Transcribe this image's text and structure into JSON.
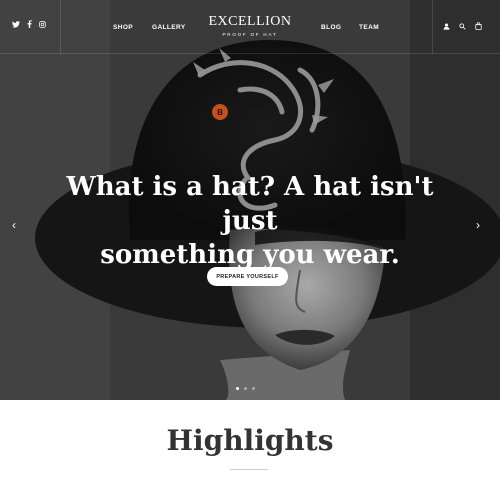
{
  "nav": {
    "social_icons": [
      "twitter-icon",
      "facebook-icon",
      "instagram-icon"
    ],
    "links_left": [
      "SHOP",
      "GALLERY"
    ],
    "links_right": [
      "BLOG",
      "TEAM"
    ],
    "logo": {
      "main": "EXCELLION",
      "sub": "PROOF OF HAT"
    },
    "icons_right": [
      "user-icon",
      "search-icon",
      "cart-icon"
    ]
  },
  "hero": {
    "headline_line1": "What is a hat? A hat isn't just",
    "headline_line2": "something you wear.",
    "cta_label": "PREPARE YOURSELF",
    "prev_arrow": "‹",
    "next_arrow": "›",
    "slides": {
      "count": 3,
      "active": 1
    }
  },
  "highlights": {
    "title": "Highlights"
  },
  "colors": {
    "hero_dark": "#1e1e1e",
    "text_light": "#ffffff",
    "heading_dark": "#333333",
    "coin_orange": "#c8501a"
  }
}
